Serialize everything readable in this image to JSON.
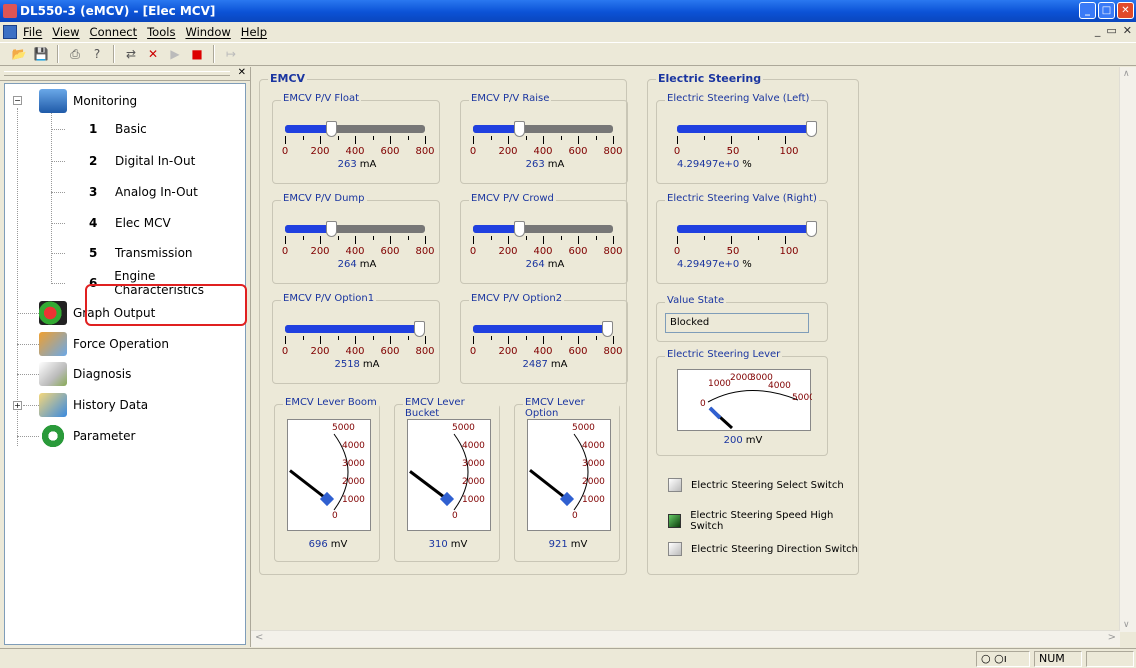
{
  "window": {
    "title": "DL550-3 (eMCV) - [Elec MCV]"
  },
  "menu": {
    "items": [
      "File",
      "View",
      "Connect",
      "Tools",
      "Window",
      "Help"
    ]
  },
  "tree": {
    "root_monitoring": "Monitoring",
    "children": [
      {
        "num": "1",
        "label": "Basic"
      },
      {
        "num": "2",
        "label": "Digital In-Out"
      },
      {
        "num": "3",
        "label": "Analog In-Out"
      },
      {
        "num": "4",
        "label": "Elec MCV"
      },
      {
        "num": "5",
        "label": "Transmission"
      },
      {
        "num": "6",
        "label": "Engine Characteristics"
      }
    ],
    "others": [
      "Graph Output",
      "Force Operation",
      "Diagnosis",
      "History Data",
      "Parameter"
    ]
  },
  "emcv": {
    "title": "EMCV",
    "slider_ticks": [
      "0",
      "200",
      "400",
      "600",
      "800"
    ],
    "sliders": [
      {
        "label": "EMCV P/V Float",
        "value": "263",
        "unit": "mA",
        "level": 0.33
      },
      {
        "label": "EMCV P/V Raise",
        "value": "263",
        "unit": "mA",
        "level": 0.33
      },
      {
        "label": "EMCV P/V Dump",
        "value": "264",
        "unit": "mA",
        "level": 0.33
      },
      {
        "label": "EMCV P/V Crowd",
        "value": "264",
        "unit": "mA",
        "level": 0.33
      },
      {
        "label": "EMCV P/V Option1",
        "value": "2518",
        "unit": "mA",
        "level": 1.0
      },
      {
        "label": "EMCV P/V Option2",
        "value": "2487",
        "unit": "mA",
        "level": 1.0
      }
    ],
    "gauge_ticks": [
      "5000",
      "4000",
      "3000",
      "2000",
      "1000",
      "0"
    ],
    "gauges": [
      {
        "label": "EMCV Lever Boom",
        "value": "696",
        "unit": "mV",
        "level": 0.139
      },
      {
        "label": "EMCV Lever Bucket",
        "value": "310",
        "unit": "mV",
        "level": 0.062
      },
      {
        "label": "EMCV Lever Option",
        "value": "921",
        "unit": "mV",
        "level": 0.184
      }
    ]
  },
  "steering": {
    "title": "Electric Steering",
    "pct_ticks": [
      "0",
      "50",
      "100"
    ],
    "valves": [
      {
        "label": "Electric Steering Valve (Left)",
        "value": "4.29497e+0",
        "unit": "%",
        "level": 1.0
      },
      {
        "label": "Electric Steering Valve (Right)",
        "value": "4.29497e+0",
        "unit": "%",
        "level": 1.0
      }
    ],
    "value_state": {
      "label": "Value State",
      "value": "Blocked"
    },
    "lever": {
      "label": "Electric Steering Lever",
      "ticks": [
        "0",
        "1000",
        "2000",
        "3000",
        "4000",
        "5000"
      ],
      "value": "200",
      "unit": "mV",
      "level": 0.04
    },
    "switches": [
      {
        "label": "Electric Steering Select Switch",
        "on": false
      },
      {
        "label": "Electric Steering Speed High Switch",
        "on": true
      },
      {
        "label": "Electric Steering Direction Switch",
        "on": false
      }
    ]
  },
  "status": {
    "num": "NUM"
  },
  "colors": {
    "fill": "#2040e0",
    "tick_label": "#800000",
    "readout": "#1a35a0",
    "titlebar": "#0b52d6"
  }
}
